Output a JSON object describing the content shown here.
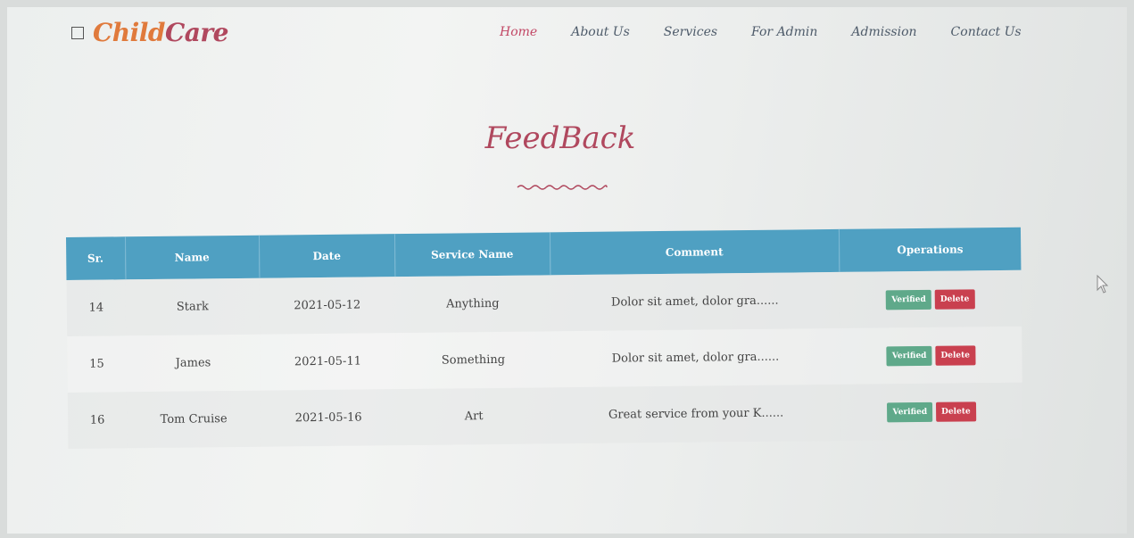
{
  "brand": {
    "part1": "Child",
    "part2": "Care"
  },
  "nav": {
    "items": [
      {
        "label": "Home",
        "active": true
      },
      {
        "label": "About Us",
        "active": false
      },
      {
        "label": "Services",
        "active": false
      },
      {
        "label": "For Admin",
        "active": false
      },
      {
        "label": "Admission",
        "active": false
      },
      {
        "label": "Contact Us",
        "active": false
      }
    ]
  },
  "page": {
    "title": "FeedBack"
  },
  "table": {
    "headers": [
      "Sr.",
      "Name",
      "Date",
      "Service Name",
      "Comment",
      "Operations"
    ],
    "rows": [
      {
        "sr": "14",
        "name": "Stark",
        "date": "2021-05-12",
        "service": "Anything",
        "comment": "Dolor sit amet, dolor gra......"
      },
      {
        "sr": "15",
        "name": "James",
        "date": "2021-05-11",
        "service": "Something",
        "comment": "Dolor sit amet, dolor gra......"
      },
      {
        "sr": "16",
        "name": "Tom Cruise",
        "date": "2021-05-16",
        "service": "Art",
        "comment": "Great service from your K......"
      }
    ],
    "verified_label": "Verified",
    "delete_label": "Delete"
  },
  "colors": {
    "accent": "#b0485e",
    "brand_orange": "#e07a3c",
    "header_blue": "#4fa0c2",
    "verified_green": "#5fa98a",
    "delete_red": "#c9404f"
  }
}
